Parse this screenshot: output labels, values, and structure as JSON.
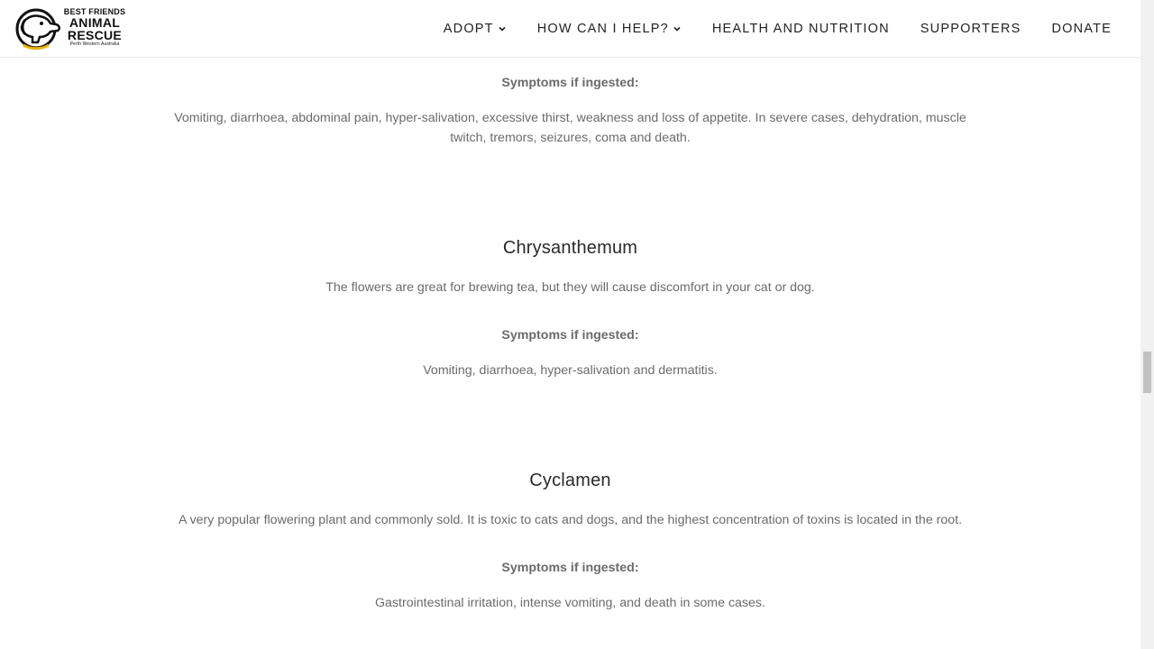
{
  "header": {
    "logo": {
      "line1": "BEST FRIENDS",
      "line2": "ANIMAL",
      "line3": "RESCUE",
      "line4": "Perth Western Australia",
      "accent": "#e5b400"
    },
    "nav": [
      {
        "label": "ADOPT",
        "has_dropdown": true
      },
      {
        "label": "HOW CAN I HELP?",
        "has_dropdown": true
      },
      {
        "label": "HEALTH AND NUTRITION",
        "has_dropdown": false
      },
      {
        "label": "SUPPORTERS",
        "has_dropdown": false
      },
      {
        "label": "DONATE",
        "has_dropdown": false
      }
    ]
  },
  "sections": {
    "top": {
      "symptoms_label": "Symptoms if ingested:",
      "symptoms": "Vomiting, diarrhoea, abdominal pain, hyper-salivation, excessive thirst, weakness and loss of appetite. In severe cases, dehydration, muscle twitch, tremors, seizures, coma and death."
    },
    "chrysanthemum": {
      "title": "Chrysanthemum",
      "description": "The flowers are great for brewing tea, but they will cause discomfort in your cat or dog.",
      "symptoms_label": "Symptoms if ingested:",
      "symptoms": "Vomiting, diarrhoea, hyper-salivation and dermatitis."
    },
    "cyclamen": {
      "title": "Cyclamen",
      "description": "A very popular flowering plant and commonly sold. It is toxic to cats and dogs, and the highest concentration of toxins is located in the root.",
      "symptoms_label": "Symptoms if ingested:",
      "symptoms": "Gastrointestinal irritation, intense vomiting, and death in some cases."
    }
  },
  "colors": {
    "heading": "#2a2a2a",
    "body": "#6b6b6b",
    "nav": "#222222"
  }
}
